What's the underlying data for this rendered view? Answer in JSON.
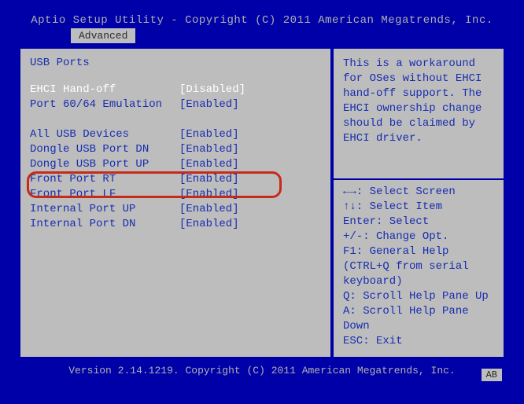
{
  "header": {
    "title": "Aptio Setup Utility - Copyright (C) 2011 American Megatrends, Inc.",
    "tab": "Advanced"
  },
  "section": {
    "title": "USB Ports"
  },
  "rows": [
    {
      "label": "EHCI Hand-off",
      "value": "[Disabled]",
      "selected": true
    },
    {
      "label": "Port 60/64 Emulation",
      "value": "[Enabled]",
      "selected": false
    },
    {
      "label": "",
      "value": "",
      "selected": false
    },
    {
      "label": "All USB Devices",
      "value": "[Enabled]",
      "selected": false
    },
    {
      "label": "Dongle USB Port DN",
      "value": "[Enabled]",
      "selected": false
    },
    {
      "label": "Dongle USB Port UP",
      "value": "[Enabled]",
      "selected": false
    },
    {
      "label": "Front Port RT",
      "value": "[Enabled]",
      "selected": false
    },
    {
      "label": "Front Port LF",
      "value": "[Enabled]",
      "selected": false
    },
    {
      "label": "Internal Port UP",
      "value": "[Enabled]",
      "selected": false
    },
    {
      "label": "Internal Port DN",
      "value": "[Enabled]",
      "selected": false
    }
  ],
  "help": {
    "text": "This is a workaround for OSes without EHCI hand-off support. The EHCI ownership change should be claimed by EHCI driver."
  },
  "hints": {
    "l1": "←→: Select Screen",
    "l2": "↑↓: Select Item",
    "l3": "Enter: Select",
    "l4": "+/-: Change Opt.",
    "l5": "F1: General Help",
    "l6": "(CTRL+Q from serial",
    "l7": "keyboard)",
    "l8": "Q: Scroll Help Pane Up",
    "l9": "A: Scroll Help Pane Down",
    "l10": "ESC: Exit"
  },
  "footer": {
    "version": "Version 2.14.1219. Copyright (C) 2011 American Megatrends, Inc.",
    "kb": "AB"
  }
}
